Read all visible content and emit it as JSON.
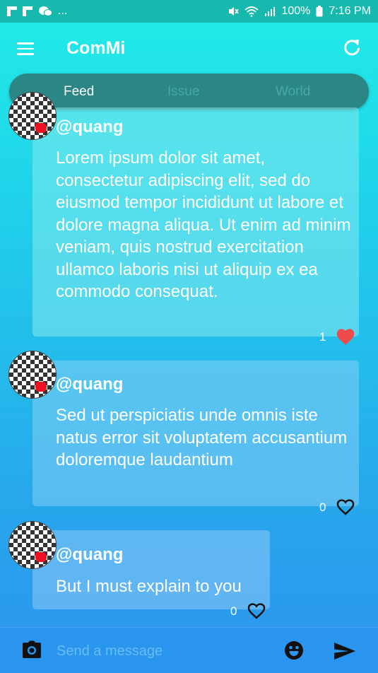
{
  "status_bar": {
    "left_ellipsis": "...",
    "battery": "100%",
    "time": "7:16 PM"
  },
  "app": {
    "title": "ComMi"
  },
  "tabs": [
    {
      "label": "Feed",
      "active": true
    },
    {
      "label": "Issue",
      "active": false
    },
    {
      "label": "World",
      "active": false
    }
  ],
  "posts": [
    {
      "user": "@quang",
      "text": "Lorem ipsum dolor sit amet, consectetur adipiscing elit, sed do eiusmod tempor incididunt ut labore et dolore magna aliqua. Ut enim ad minim veniam, quis nostrud exercitation ullamco laboris nisi ut aliquip ex ea commodo consequat.",
      "likes": "1",
      "liked": true
    },
    {
      "user": "@quang",
      "text": "Sed ut perspiciatis unde omnis iste natus error sit voluptatem accusantium doloremque laudantium",
      "likes": "0",
      "liked": false
    },
    {
      "user": "@quang",
      "text": "But I must explain to you",
      "likes": "0",
      "liked": false
    }
  ],
  "composer": {
    "placeholder": "Send a message"
  },
  "colors": {
    "status_bar": "#17b8ad",
    "tab_bar": "#2b8686",
    "heart_liked": "#f04a4a",
    "bottom_bar": "#2a95ee"
  },
  "icons": {
    "menu": "menu-icon",
    "refresh": "refresh-icon",
    "heart": "heart-icon",
    "camera": "camera-icon",
    "emoji": "emoji-icon",
    "send": "send-icon"
  }
}
